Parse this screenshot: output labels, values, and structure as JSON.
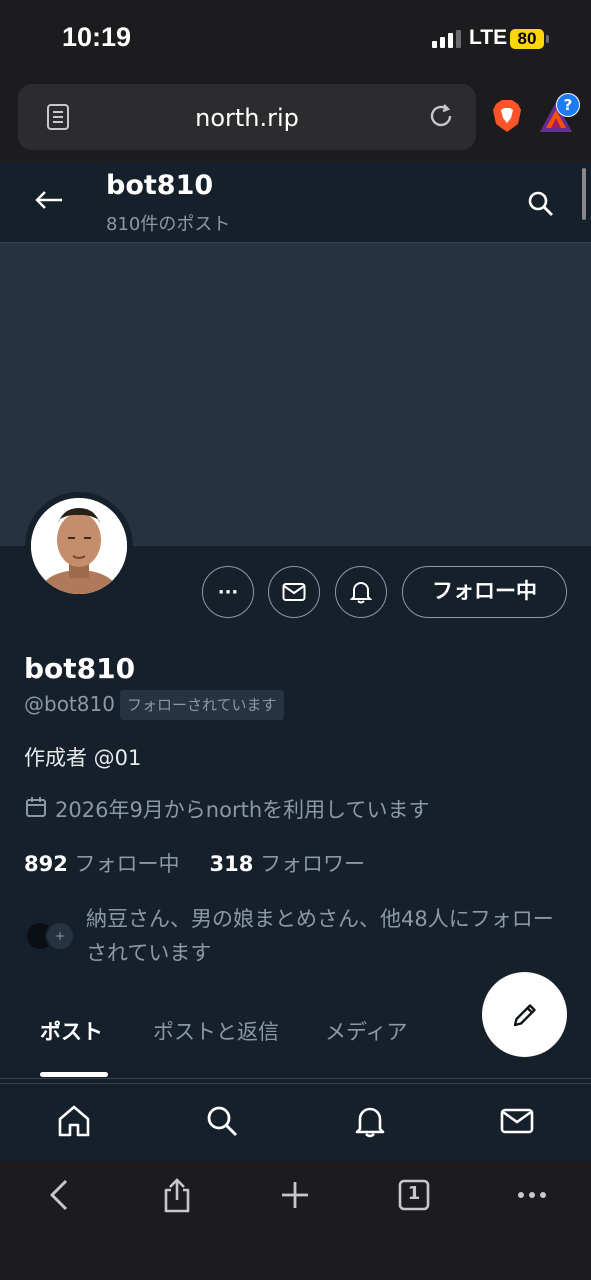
{
  "status": {
    "time": "10:19",
    "network": "LTE",
    "battery": "80"
  },
  "browser": {
    "url": "north.rip",
    "extension_badge": "?"
  },
  "header": {
    "title": "bot810",
    "subtitle": "810件のポスト"
  },
  "profile": {
    "display_name": "bot810",
    "handle": "@bot810",
    "follows_you": "フォローされています",
    "bio": "作成者 @01",
    "joined": "2026年9月からnorthを利用しています",
    "following_count": "892",
    "following_label": "フォロー中",
    "followers_count": "318",
    "followers_label": "フォロワー",
    "followed_by": "納豆さん、男の娘まとめさん、他48人にフォローされています"
  },
  "actions": {
    "follow_label": "フォロー中",
    "more_label": "···"
  },
  "tabs": [
    {
      "label": "ポスト",
      "active": true
    },
    {
      "label": "ポストと返信",
      "active": false
    },
    {
      "label": "メディア",
      "active": false
    }
  ],
  "browser_toolbar": {
    "tab_count": "1"
  },
  "colors": {
    "background": "#15202b",
    "banner": "#253341",
    "muted": "#8b98a5"
  }
}
